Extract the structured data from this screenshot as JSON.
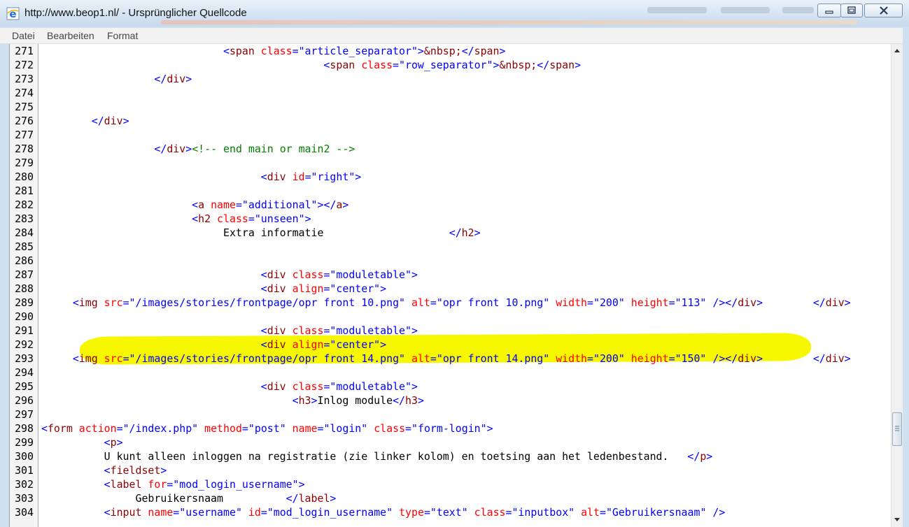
{
  "window": {
    "title": "http://www.beop1.nl/ - Ursprünglicher Quellcode"
  },
  "menu": [
    "Datei",
    "Bearbeiten",
    "Format"
  ],
  "colors": {
    "tag": "#8b0000",
    "attr": "#ff0000",
    "value": "#0000ff",
    "comment": "#008000",
    "highlight": "#f7f700"
  },
  "highlighted_line": 289,
  "source": [
    {
      "n": "271",
      "segs": [
        [
          "p",
          "                             "
        ],
        [
          "b",
          "<"
        ],
        [
          "t",
          "span "
        ],
        [
          "a",
          "class"
        ],
        [
          "b",
          "="
        ],
        [
          "v",
          "\"article_separator\""
        ],
        [
          "b",
          ">"
        ],
        [
          "t",
          "&nbsp;"
        ],
        [
          "b",
          "</"
        ],
        [
          "t",
          "span"
        ],
        [
          "b",
          ">"
        ]
      ]
    },
    {
      "n": "272",
      "segs": [
        [
          "p",
          "                                             "
        ],
        [
          "b",
          "<"
        ],
        [
          "t",
          "span "
        ],
        [
          "a",
          "class"
        ],
        [
          "b",
          "="
        ],
        [
          "v",
          "\"row_separator\""
        ],
        [
          "b",
          ">"
        ],
        [
          "t",
          "&nbsp;"
        ],
        [
          "b",
          "</"
        ],
        [
          "t",
          "span"
        ],
        [
          "b",
          ">"
        ]
      ]
    },
    {
      "n": "273",
      "segs": [
        [
          "p",
          "                  "
        ],
        [
          "b",
          "</"
        ],
        [
          "t",
          "div"
        ],
        [
          "b",
          ">"
        ]
      ]
    },
    {
      "n": "274",
      "segs": []
    },
    {
      "n": "275",
      "segs": []
    },
    {
      "n": "276",
      "segs": [
        [
          "p",
          "        "
        ],
        [
          "b",
          "</"
        ],
        [
          "t",
          "div"
        ],
        [
          "b",
          ">"
        ]
      ]
    },
    {
      "n": "277",
      "segs": []
    },
    {
      "n": "278",
      "segs": [
        [
          "p",
          "                  "
        ],
        [
          "b",
          "</"
        ],
        [
          "t",
          "div"
        ],
        [
          "b",
          ">"
        ],
        [
          "c",
          "<!-- end main or main2 -->"
        ]
      ]
    },
    {
      "n": "279",
      "segs": []
    },
    {
      "n": "280",
      "segs": [
        [
          "p",
          "                                   "
        ],
        [
          "b",
          "<"
        ],
        [
          "t",
          "div "
        ],
        [
          "a",
          "id"
        ],
        [
          "b",
          "="
        ],
        [
          "v",
          "\"right\""
        ],
        [
          "b",
          ">"
        ]
      ]
    },
    {
      "n": "281",
      "segs": []
    },
    {
      "n": "282",
      "segs": [
        [
          "p",
          "                        "
        ],
        [
          "b",
          "<"
        ],
        [
          "t",
          "a "
        ],
        [
          "a",
          "name"
        ],
        [
          "b",
          "="
        ],
        [
          "v",
          "\"additional\""
        ],
        [
          "b",
          "></"
        ],
        [
          "t",
          "a"
        ],
        [
          "b",
          ">"
        ]
      ]
    },
    {
      "n": "283",
      "segs": [
        [
          "p",
          "                        "
        ],
        [
          "b",
          "<"
        ],
        [
          "t",
          "h2 "
        ],
        [
          "a",
          "class"
        ],
        [
          "b",
          "="
        ],
        [
          "v",
          "\"unseen\""
        ],
        [
          "b",
          ">"
        ]
      ]
    },
    {
      "n": "284",
      "segs": [
        [
          "p",
          "                             Extra informatie                    "
        ],
        [
          "b",
          "</"
        ],
        [
          "t",
          "h2"
        ],
        [
          "b",
          ">"
        ]
      ]
    },
    {
      "n": "285",
      "segs": []
    },
    {
      "n": "286",
      "segs": []
    },
    {
      "n": "287",
      "segs": [
        [
          "p",
          "                                   "
        ],
        [
          "b",
          "<"
        ],
        [
          "t",
          "div "
        ],
        [
          "a",
          "class"
        ],
        [
          "b",
          "="
        ],
        [
          "v",
          "\"moduletable\""
        ],
        [
          "b",
          ">"
        ]
      ]
    },
    {
      "n": "288",
      "segs": [
        [
          "p",
          "                                   "
        ],
        [
          "b",
          "<"
        ],
        [
          "t",
          "div "
        ],
        [
          "a",
          "align"
        ],
        [
          "b",
          "="
        ],
        [
          "v",
          "\"center\""
        ],
        [
          "b",
          ">"
        ]
      ]
    },
    {
      "n": "289",
      "segs": [
        [
          "p",
          "     "
        ],
        [
          "b",
          "<"
        ],
        [
          "t",
          "img "
        ],
        [
          "a",
          "src"
        ],
        [
          "b",
          "="
        ],
        [
          "v",
          "\"/images/stories/frontpage/opr front 10.png\""
        ],
        [
          "a",
          " alt"
        ],
        [
          "b",
          "="
        ],
        [
          "v",
          "\"opr front 10.png\""
        ],
        [
          "a",
          " width"
        ],
        [
          "b",
          "="
        ],
        [
          "v",
          "\"200\""
        ],
        [
          "a",
          " height"
        ],
        [
          "b",
          "="
        ],
        [
          "v",
          "\"113\""
        ],
        [
          "b",
          " /></"
        ],
        [
          "t",
          "div"
        ],
        [
          "b",
          ">"
        ],
        [
          "p",
          "        "
        ],
        [
          "b",
          "</"
        ],
        [
          "t",
          "div"
        ],
        [
          "b",
          ">"
        ]
      ]
    },
    {
      "n": "290",
      "segs": []
    },
    {
      "n": "291",
      "segs": [
        [
          "p",
          "                                   "
        ],
        [
          "b",
          "<"
        ],
        [
          "t",
          "div "
        ],
        [
          "a",
          "class"
        ],
        [
          "b",
          "="
        ],
        [
          "v",
          "\"moduletable\""
        ],
        [
          "b",
          ">"
        ]
      ]
    },
    {
      "n": "292",
      "segs": [
        [
          "p",
          "                                   "
        ],
        [
          "b",
          "<"
        ],
        [
          "t",
          "div "
        ],
        [
          "a",
          "align"
        ],
        [
          "b",
          "="
        ],
        [
          "v",
          "\"center\""
        ],
        [
          "b",
          ">"
        ]
      ]
    },
    {
      "n": "293",
      "segs": [
        [
          "p",
          "     "
        ],
        [
          "b",
          "<"
        ],
        [
          "t",
          "img "
        ],
        [
          "a",
          "src"
        ],
        [
          "b",
          "="
        ],
        [
          "v",
          "\"/images/stories/frontpage/opr front 14.png\""
        ],
        [
          "a",
          " alt"
        ],
        [
          "b",
          "="
        ],
        [
          "v",
          "\"opr front 14.png\""
        ],
        [
          "a",
          " width"
        ],
        [
          "b",
          "="
        ],
        [
          "v",
          "\"200\""
        ],
        [
          "a",
          " height"
        ],
        [
          "b",
          "="
        ],
        [
          "v",
          "\"150\""
        ],
        [
          "b",
          " /></"
        ],
        [
          "t",
          "div"
        ],
        [
          "b",
          ">"
        ],
        [
          "p",
          "        "
        ],
        [
          "b",
          "</"
        ],
        [
          "t",
          "div"
        ],
        [
          "b",
          ">"
        ]
      ]
    },
    {
      "n": "294",
      "segs": []
    },
    {
      "n": "295",
      "segs": [
        [
          "p",
          "                                   "
        ],
        [
          "b",
          "<"
        ],
        [
          "t",
          "div "
        ],
        [
          "a",
          "class"
        ],
        [
          "b",
          "="
        ],
        [
          "v",
          "\"moduletable\""
        ],
        [
          "b",
          ">"
        ]
      ]
    },
    {
      "n": "296",
      "segs": [
        [
          "p",
          "                                        "
        ],
        [
          "b",
          "<"
        ],
        [
          "t",
          "h3"
        ],
        [
          "b",
          ">"
        ],
        [
          "p",
          "Inlog module"
        ],
        [
          "b",
          "</"
        ],
        [
          "t",
          "h3"
        ],
        [
          "b",
          ">"
        ]
      ]
    },
    {
      "n": "297",
      "segs": []
    },
    {
      "n": "298",
      "segs": [
        [
          "b",
          "<"
        ],
        [
          "t",
          "form "
        ],
        [
          "a",
          "action"
        ],
        [
          "b",
          "="
        ],
        [
          "v",
          "\"/index.php\""
        ],
        [
          "a",
          " method"
        ],
        [
          "b",
          "="
        ],
        [
          "v",
          "\"post\""
        ],
        [
          "a",
          " name"
        ],
        [
          "b",
          "="
        ],
        [
          "v",
          "\"login\""
        ],
        [
          "a",
          " class"
        ],
        [
          "b",
          "="
        ],
        [
          "v",
          "\"form-login\""
        ],
        [
          "b",
          ">"
        ]
      ]
    },
    {
      "n": "299",
      "segs": [
        [
          "p",
          "          "
        ],
        [
          "b",
          "<"
        ],
        [
          "t",
          "p"
        ],
        [
          "b",
          ">"
        ]
      ]
    },
    {
      "n": "300",
      "segs": [
        [
          "p",
          "          U kunt alleen inloggen na registratie (zie linker kolom) en toetsing aan het ledenbestand.   "
        ],
        [
          "b",
          "</"
        ],
        [
          "t",
          "p"
        ],
        [
          "b",
          ">"
        ]
      ]
    },
    {
      "n": "301",
      "segs": [
        [
          "p",
          "          "
        ],
        [
          "b",
          "<"
        ],
        [
          "t",
          "fieldset"
        ],
        [
          "b",
          ">"
        ]
      ]
    },
    {
      "n": "302",
      "segs": [
        [
          "p",
          "          "
        ],
        [
          "b",
          "<"
        ],
        [
          "t",
          "label "
        ],
        [
          "a",
          "for"
        ],
        [
          "b",
          "="
        ],
        [
          "v",
          "\"mod_login_username\""
        ],
        [
          "b",
          ">"
        ]
      ]
    },
    {
      "n": "303",
      "segs": [
        [
          "p",
          "               Gebruikersnaam          "
        ],
        [
          "b",
          "</"
        ],
        [
          "t",
          "label"
        ],
        [
          "b",
          ">"
        ]
      ]
    },
    {
      "n": "304",
      "segs": [
        [
          "p",
          "          "
        ],
        [
          "b",
          "<"
        ],
        [
          "t",
          "input "
        ],
        [
          "a",
          "name"
        ],
        [
          "b",
          "="
        ],
        [
          "v",
          "\"username\""
        ],
        [
          "a",
          " id"
        ],
        [
          "b",
          "="
        ],
        [
          "v",
          "\"mod_login_username\""
        ],
        [
          "a",
          " type"
        ],
        [
          "b",
          "="
        ],
        [
          "v",
          "\"text\""
        ],
        [
          "a",
          " class"
        ],
        [
          "b",
          "="
        ],
        [
          "v",
          "\"inputbox\""
        ],
        [
          "a",
          " alt"
        ],
        [
          "b",
          "="
        ],
        [
          "v",
          "\"Gebruikersnaam\""
        ],
        [
          "b",
          " />"
        ]
      ]
    }
  ]
}
